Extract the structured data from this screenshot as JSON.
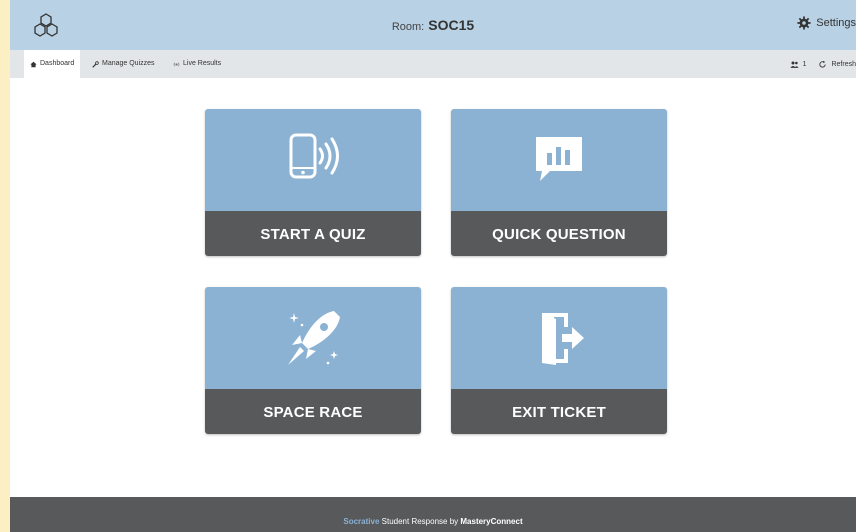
{
  "header": {
    "room_label": "Room:",
    "room_name": "SOC15",
    "settings_label": "Settings"
  },
  "nav": {
    "tabs": [
      {
        "label": "Dashboard",
        "icon": "home-icon",
        "active": true
      },
      {
        "label": "Manage Quizzes",
        "icon": "wrench-icon",
        "active": false
      },
      {
        "label": "Live Results",
        "icon": "live-icon",
        "active": false
      }
    ],
    "students_count": "1",
    "refresh_label": "Refresh"
  },
  "tiles": [
    {
      "label": "START A QUIZ",
      "icon": "phone-broadcast-icon"
    },
    {
      "label": "QUICK QUESTION",
      "icon": "chart-bubble-icon"
    },
    {
      "label": "SPACE RACE",
      "icon": "rocket-icon"
    },
    {
      "label": "EXIT TICKET",
      "icon": "door-exit-icon"
    }
  ],
  "footer": {
    "brand": "Socrative",
    "middle": "Student Response by",
    "company": "MasteryConnect"
  },
  "colors": {
    "tile_top": "#8bb1d3",
    "tile_bottom": "#58595b",
    "header": "#b8d1e4"
  }
}
